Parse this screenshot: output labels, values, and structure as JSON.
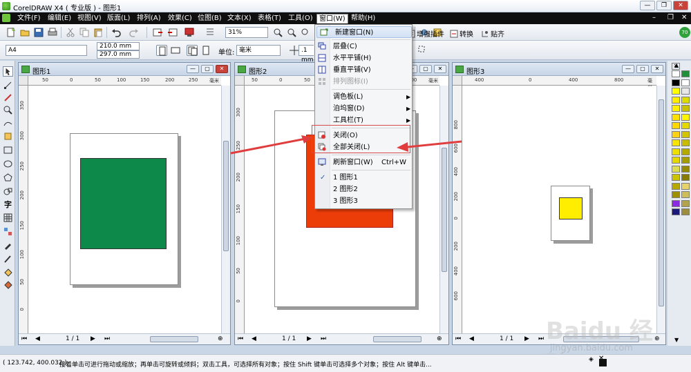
{
  "app": {
    "title": "CorelDRAW X4 ( 专业版 ) - 图形1"
  },
  "menubar": {
    "items": [
      "文件(F)",
      "编辑(E)",
      "视图(V)",
      "版面(L)",
      "排列(A)",
      "效果(C)",
      "位图(B)",
      "文本(X)",
      "表格(T)",
      "工具(O)",
      "窗口(W)",
      "帮助(H)"
    ],
    "active_index": 10
  },
  "toolbar": {
    "zoom": "31%",
    "plugins": [
      "增强插件",
      "转换",
      "贴齐"
    ]
  },
  "propbar": {
    "paper": "A4",
    "width": "210.0 mm",
    "height": "297.0 mm",
    "unit_label": "单位:",
    "unit_value": "毫米",
    "nudge": ".1 mm"
  },
  "window_menu": {
    "items": [
      {
        "label": "新建窗口(N)",
        "icon": "new-window-icon",
        "highlight": true
      },
      {
        "label": "层叠(C)",
        "icon": "cascade-icon"
      },
      {
        "label": "水平平铺(H)",
        "icon": "tile-horizontal-icon"
      },
      {
        "label": "垂直平铺(V)",
        "icon": "tile-vertical-icon"
      },
      {
        "label": "排列图标(I)",
        "icon": "arrange-icons-icon",
        "disabled": true
      },
      {
        "label": "调色板(L)",
        "submenu": true
      },
      {
        "label": "泊坞窗(D)",
        "submenu": true
      },
      {
        "label": "工具栏(T)",
        "submenu": true
      },
      {
        "label": "关闭(O)",
        "icon": "close-window-icon"
      },
      {
        "label": "全部关闭(L)",
        "icon": "close-all-icon"
      },
      {
        "label": "刷新窗口(W)",
        "icon": "refresh-window-icon",
        "accelerator": "Ctrl+W"
      },
      {
        "label": "1 图形1",
        "checked": true
      },
      {
        "label": "2 图形2"
      },
      {
        "label": "3 图形3"
      }
    ]
  },
  "documents": [
    {
      "title": "图形1",
      "shape_color": "#0d8a4a",
      "page_nav": "1 / 1",
      "ruler_h": [
        "50",
        "0",
        "50",
        "100",
        "150",
        "200",
        "250",
        "毫米"
      ],
      "ruler_v": [
        "350",
        "300",
        "250",
        "200",
        "150",
        "100",
        "50",
        "0"
      ]
    },
    {
      "title": "图形2",
      "shape_color": "#ec3d09",
      "page_nav": "1 / 1",
      "ruler_h": [
        "50",
        "0",
        "50",
        "100",
        "150",
        "200",
        "毫米"
      ],
      "ruler_v": [
        "300",
        "250",
        "200",
        "150",
        "100",
        "50",
        "0"
      ]
    },
    {
      "title": "图形3",
      "shape_color": "#ffee00",
      "page_nav": "1 / 1",
      "ruler_h": [
        "400",
        "0",
        "400",
        "800",
        "毫米"
      ],
      "ruler_v": [
        "800",
        "600",
        "400",
        "200",
        "0",
        "200",
        "400",
        "600"
      ]
    }
  ],
  "statusbar": {
    "coords": "( 123.742, 400.032 )",
    "hint": "接着单击可进行拖动或缩放；再单击可旋转或倾斜；双击工具，可选择所有对象；按住 Shift 键单击可选择多个对象；按住 Alt 键单击..."
  },
  "watermark": {
    "main": "Baidu 经验",
    "sub": "jingyan.baidu.com"
  },
  "colors": {
    "arrow_red": "#e03e3e",
    "menubar_bg": "#0f0f0f",
    "palette": [
      "#ffffff",
      "#000000",
      "#ffff00",
      "#ffed00",
      "#fff000",
      "#ffe100",
      "#ffd800",
      "#fcd116",
      "#f7e400",
      "#eee000",
      "#e5d800",
      "#dddd55",
      "#ccc400",
      "#b7a800",
      "#9e9000",
      "#8a2be2",
      "#1a1a7a",
      "#1f8f3a",
      "#ffffff",
      "#e8e8e8",
      "#dedb00",
      "#c9c200",
      "#fff700",
      "#e4da00",
      "#d2c500",
      "#c7bc00",
      "#b4a900",
      "#a59c00",
      "#968b00",
      "#877c00",
      "#e8d36b",
      "#cdbd5b",
      "#b3a34c",
      "#9c8d40"
    ]
  }
}
